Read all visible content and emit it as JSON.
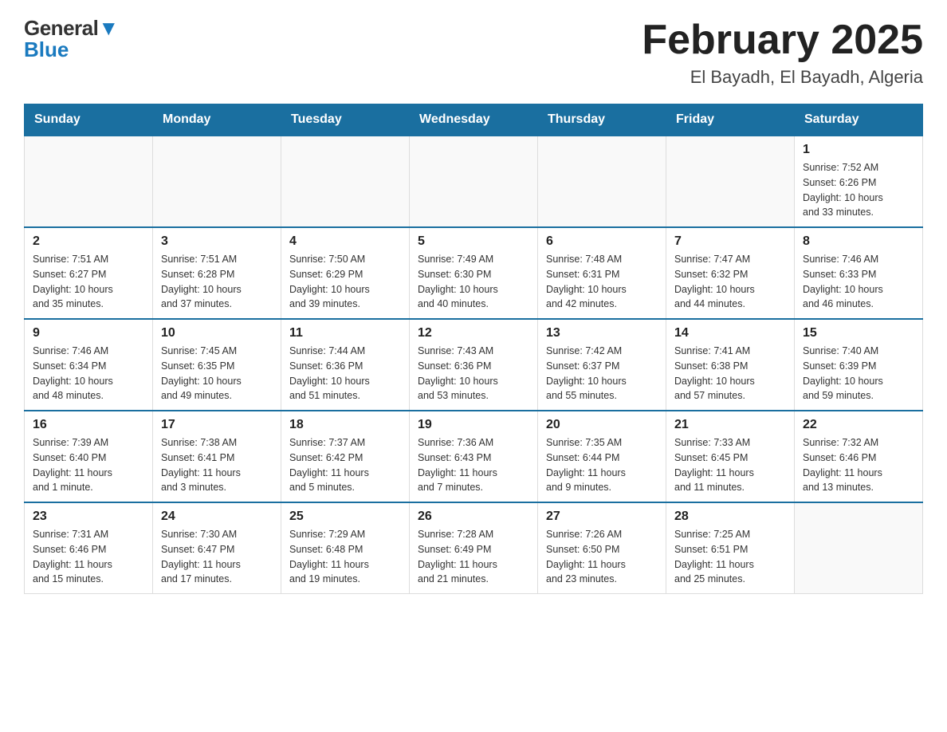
{
  "header": {
    "logo_general": "General",
    "logo_blue": "Blue",
    "title": "February 2025",
    "subtitle": "El Bayadh, El Bayadh, Algeria"
  },
  "weekdays": [
    "Sunday",
    "Monday",
    "Tuesday",
    "Wednesday",
    "Thursday",
    "Friday",
    "Saturday"
  ],
  "weeks": [
    [
      {
        "day": "",
        "info": ""
      },
      {
        "day": "",
        "info": ""
      },
      {
        "day": "",
        "info": ""
      },
      {
        "day": "",
        "info": ""
      },
      {
        "day": "",
        "info": ""
      },
      {
        "day": "",
        "info": ""
      },
      {
        "day": "1",
        "info": "Sunrise: 7:52 AM\nSunset: 6:26 PM\nDaylight: 10 hours\nand 33 minutes."
      }
    ],
    [
      {
        "day": "2",
        "info": "Sunrise: 7:51 AM\nSunset: 6:27 PM\nDaylight: 10 hours\nand 35 minutes."
      },
      {
        "day": "3",
        "info": "Sunrise: 7:51 AM\nSunset: 6:28 PM\nDaylight: 10 hours\nand 37 minutes."
      },
      {
        "day": "4",
        "info": "Sunrise: 7:50 AM\nSunset: 6:29 PM\nDaylight: 10 hours\nand 39 minutes."
      },
      {
        "day": "5",
        "info": "Sunrise: 7:49 AM\nSunset: 6:30 PM\nDaylight: 10 hours\nand 40 minutes."
      },
      {
        "day": "6",
        "info": "Sunrise: 7:48 AM\nSunset: 6:31 PM\nDaylight: 10 hours\nand 42 minutes."
      },
      {
        "day": "7",
        "info": "Sunrise: 7:47 AM\nSunset: 6:32 PM\nDaylight: 10 hours\nand 44 minutes."
      },
      {
        "day": "8",
        "info": "Sunrise: 7:46 AM\nSunset: 6:33 PM\nDaylight: 10 hours\nand 46 minutes."
      }
    ],
    [
      {
        "day": "9",
        "info": "Sunrise: 7:46 AM\nSunset: 6:34 PM\nDaylight: 10 hours\nand 48 minutes."
      },
      {
        "day": "10",
        "info": "Sunrise: 7:45 AM\nSunset: 6:35 PM\nDaylight: 10 hours\nand 49 minutes."
      },
      {
        "day": "11",
        "info": "Sunrise: 7:44 AM\nSunset: 6:36 PM\nDaylight: 10 hours\nand 51 minutes."
      },
      {
        "day": "12",
        "info": "Sunrise: 7:43 AM\nSunset: 6:36 PM\nDaylight: 10 hours\nand 53 minutes."
      },
      {
        "day": "13",
        "info": "Sunrise: 7:42 AM\nSunset: 6:37 PM\nDaylight: 10 hours\nand 55 minutes."
      },
      {
        "day": "14",
        "info": "Sunrise: 7:41 AM\nSunset: 6:38 PM\nDaylight: 10 hours\nand 57 minutes."
      },
      {
        "day": "15",
        "info": "Sunrise: 7:40 AM\nSunset: 6:39 PM\nDaylight: 10 hours\nand 59 minutes."
      }
    ],
    [
      {
        "day": "16",
        "info": "Sunrise: 7:39 AM\nSunset: 6:40 PM\nDaylight: 11 hours\nand 1 minute."
      },
      {
        "day": "17",
        "info": "Sunrise: 7:38 AM\nSunset: 6:41 PM\nDaylight: 11 hours\nand 3 minutes."
      },
      {
        "day": "18",
        "info": "Sunrise: 7:37 AM\nSunset: 6:42 PM\nDaylight: 11 hours\nand 5 minutes."
      },
      {
        "day": "19",
        "info": "Sunrise: 7:36 AM\nSunset: 6:43 PM\nDaylight: 11 hours\nand 7 minutes."
      },
      {
        "day": "20",
        "info": "Sunrise: 7:35 AM\nSunset: 6:44 PM\nDaylight: 11 hours\nand 9 minutes."
      },
      {
        "day": "21",
        "info": "Sunrise: 7:33 AM\nSunset: 6:45 PM\nDaylight: 11 hours\nand 11 minutes."
      },
      {
        "day": "22",
        "info": "Sunrise: 7:32 AM\nSunset: 6:46 PM\nDaylight: 11 hours\nand 13 minutes."
      }
    ],
    [
      {
        "day": "23",
        "info": "Sunrise: 7:31 AM\nSunset: 6:46 PM\nDaylight: 11 hours\nand 15 minutes."
      },
      {
        "day": "24",
        "info": "Sunrise: 7:30 AM\nSunset: 6:47 PM\nDaylight: 11 hours\nand 17 minutes."
      },
      {
        "day": "25",
        "info": "Sunrise: 7:29 AM\nSunset: 6:48 PM\nDaylight: 11 hours\nand 19 minutes."
      },
      {
        "day": "26",
        "info": "Sunrise: 7:28 AM\nSunset: 6:49 PM\nDaylight: 11 hours\nand 21 minutes."
      },
      {
        "day": "27",
        "info": "Sunrise: 7:26 AM\nSunset: 6:50 PM\nDaylight: 11 hours\nand 23 minutes."
      },
      {
        "day": "28",
        "info": "Sunrise: 7:25 AM\nSunset: 6:51 PM\nDaylight: 11 hours\nand 25 minutes."
      },
      {
        "day": "",
        "info": ""
      }
    ]
  ],
  "colors": {
    "header_bg": "#1a6fa0",
    "border": "#1a6fa0"
  }
}
